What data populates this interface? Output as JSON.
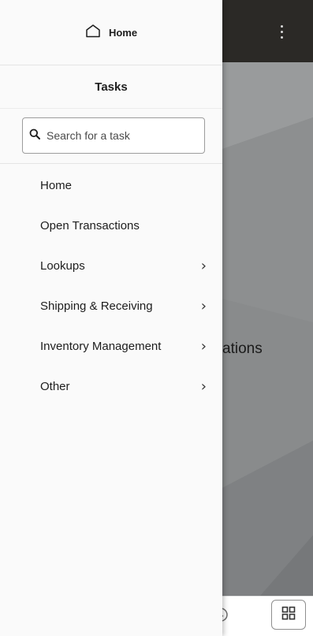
{
  "header": {
    "home_label": "Home",
    "home_icon": "home-icon"
  },
  "drawer": {
    "title": "Tasks",
    "search": {
      "placeholder": "Search for a task",
      "value": ""
    },
    "items": [
      {
        "label": "Home",
        "has_submenu": false
      },
      {
        "label": "Open Transactions",
        "has_submenu": false
      },
      {
        "label": "Lookups",
        "has_submenu": true
      },
      {
        "label": "Shipping & Receiving",
        "has_submenu": true
      },
      {
        "label": "Inventory Management",
        "has_submenu": true
      },
      {
        "label": "Other",
        "has_submenu": true
      }
    ]
  },
  "background": {
    "title_fragment": "ations",
    "topbar_color": "#2b2926",
    "hero_color": "#898b8c"
  },
  "colors": {
    "drawer_bg": "#fafafa",
    "text": "#1d1d1d"
  }
}
